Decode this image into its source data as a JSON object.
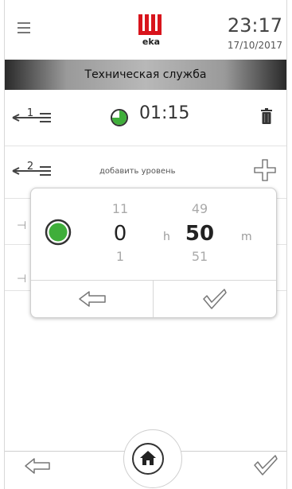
{
  "header": {
    "menu_icon": "hamburger-icon",
    "logo_text": "eka",
    "time": "23:17",
    "date": "17/10/2017"
  },
  "titlebar": {
    "title": "Техническая служба"
  },
  "levels": [
    {
      "number": "1",
      "time": "01:15",
      "timer_icon": "timer-icon",
      "delete_icon": "trash-icon"
    },
    {
      "number": "2",
      "add_label": "добавить уровень",
      "add_icon": "plus-icon"
    }
  ],
  "time_picker": {
    "hours": {
      "prev": "11",
      "current": "0",
      "next": "1",
      "unit": "h"
    },
    "minutes": {
      "prev": "49",
      "current": "50",
      "next": "51",
      "unit": "m"
    },
    "back_icon": "arrow-left-icon",
    "confirm_icon": "checkmark-icon"
  },
  "bottom_bar": {
    "back_icon": "arrow-left-icon",
    "home_icon": "home-icon",
    "confirm_icon": "checkmark-icon"
  },
  "colors": {
    "brand_red": "#d8141c",
    "timer_green": "#3fae3a"
  }
}
